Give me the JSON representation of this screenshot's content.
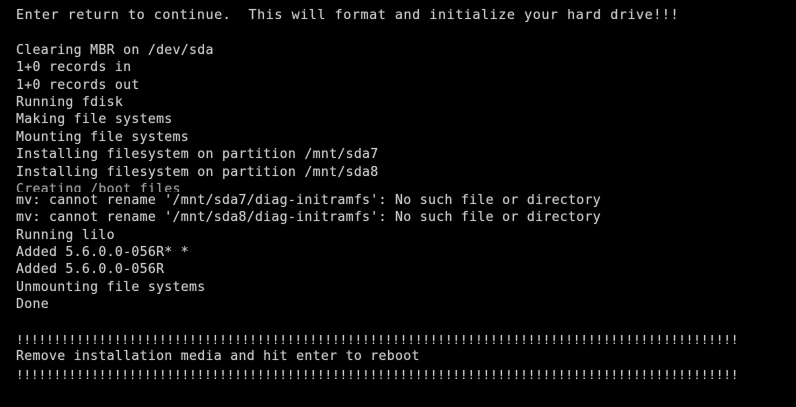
{
  "colors": {
    "background": "#000000",
    "foreground": "#c8c8c8"
  },
  "terminal": {
    "header": "Enter return to continue.  This will format and initialize your hard drive!!!",
    "log_lines": [
      "Clearing MBR on /dev/sda",
      "1+0 records in",
      "1+0 records out",
      "Running fdisk",
      "Making file systems",
      "Mounting file systems",
      "Installing filesystem on partition /mnt/sda7",
      "Installing filesystem on partition /mnt/sda8",
      "Creating /boot files",
      "mv: cannot rename '/mnt/sda7/diag-initramfs': No such file or directory",
      "mv: cannot rename '/mnt/sda8/diag-initramfs': No such file or directory",
      "Running lilo",
      "Added 5.6.0.0-056R* *",
      "Added 5.6.0.0-056R",
      "Unmounting file systems",
      "Done"
    ],
    "separator": "!!!!!!!!!!!!!!!!!!!!!!!!!!!!!!!!!!!!!!!!!!!!!!!!!!!!!!!!!!!!!!!!!!!!!!!!!!!!!!!!!!!!!!!!!!!!!!!!",
    "prompt": "Remove installation media and hit enter to reboot"
  }
}
